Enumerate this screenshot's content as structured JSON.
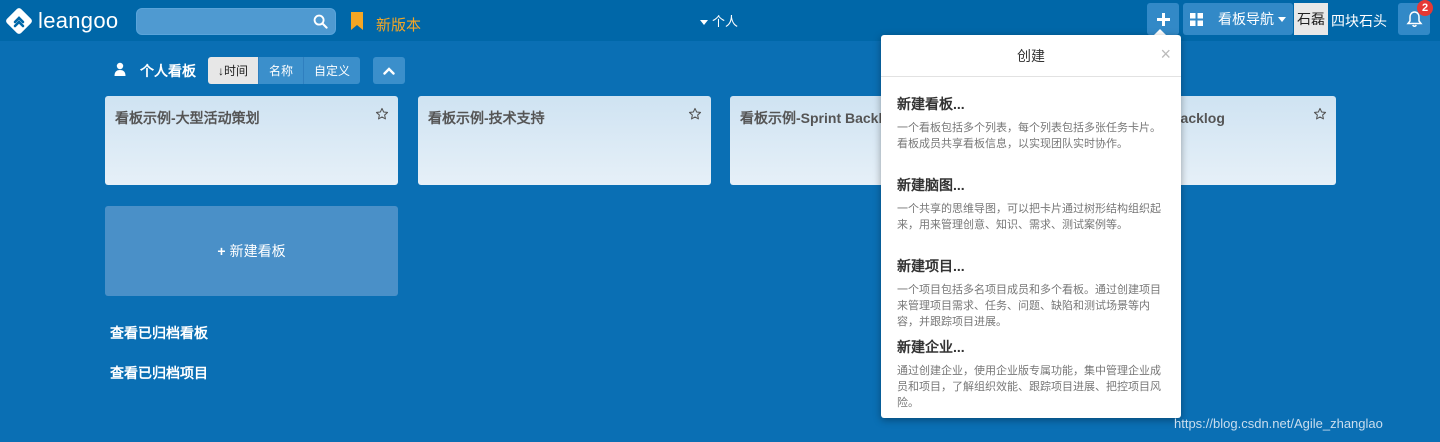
{
  "header": {
    "logo_text": "leangoo",
    "search_placeholder": "",
    "new_version": "新版本",
    "personal_menu": "个人",
    "board_nav": "看板导航",
    "avatar_text": "石磊",
    "user_name": "四块石头",
    "notification_count": "2"
  },
  "toolbar": {
    "title": "个人看板",
    "sort_options": [
      "时间",
      "名称",
      "自定义"
    ],
    "sort_active_prefix": "↓"
  },
  "boards": [
    {
      "name": "看板示例-大型活动策划"
    },
    {
      "name": "看板示例-技术支持"
    },
    {
      "name": "看板示例-Sprint Backlog"
    },
    {
      "name": "看板示例-Product Backlog"
    }
  ],
  "new_board": {
    "label": "新建看板",
    "icon": "plus-icon"
  },
  "archive_links": [
    "查看已归档看板",
    "查看已归档项目"
  ],
  "popover": {
    "title": "创建",
    "close": "×",
    "items": [
      {
        "title": "新建看板...",
        "desc": "一个看板包括多个列表，每个列表包括多张任务卡片。看板成员共享看板信息，以实现团队实时协作。"
      },
      {
        "title": "新建脑图...",
        "desc": "一个共享的思维导图，可以把卡片通过树形结构组织起来，用来管理创意、知识、需求、测试案例等。"
      },
      {
        "title": "新建项目...",
        "desc": "一个项目包括多名项目成员和多个看板。通过创建项目来管理项目需求、任务、问题、缺陷和测试场景等内容，并跟踪项目进展。"
      },
      {
        "title": "新建企业...",
        "desc": "通过创建企业，使用企业版专属功能，集中管理企业成员和项目，了解组织效能、跟踪项目进展、把控项目风险。"
      }
    ]
  },
  "watermark": "https://blog.csdn.net/Agile_zhanglao",
  "colors": {
    "background": "#0a6fb4",
    "topbar": "#0067a8",
    "accent_orange": "#f5a623",
    "badge": "#e53935"
  }
}
